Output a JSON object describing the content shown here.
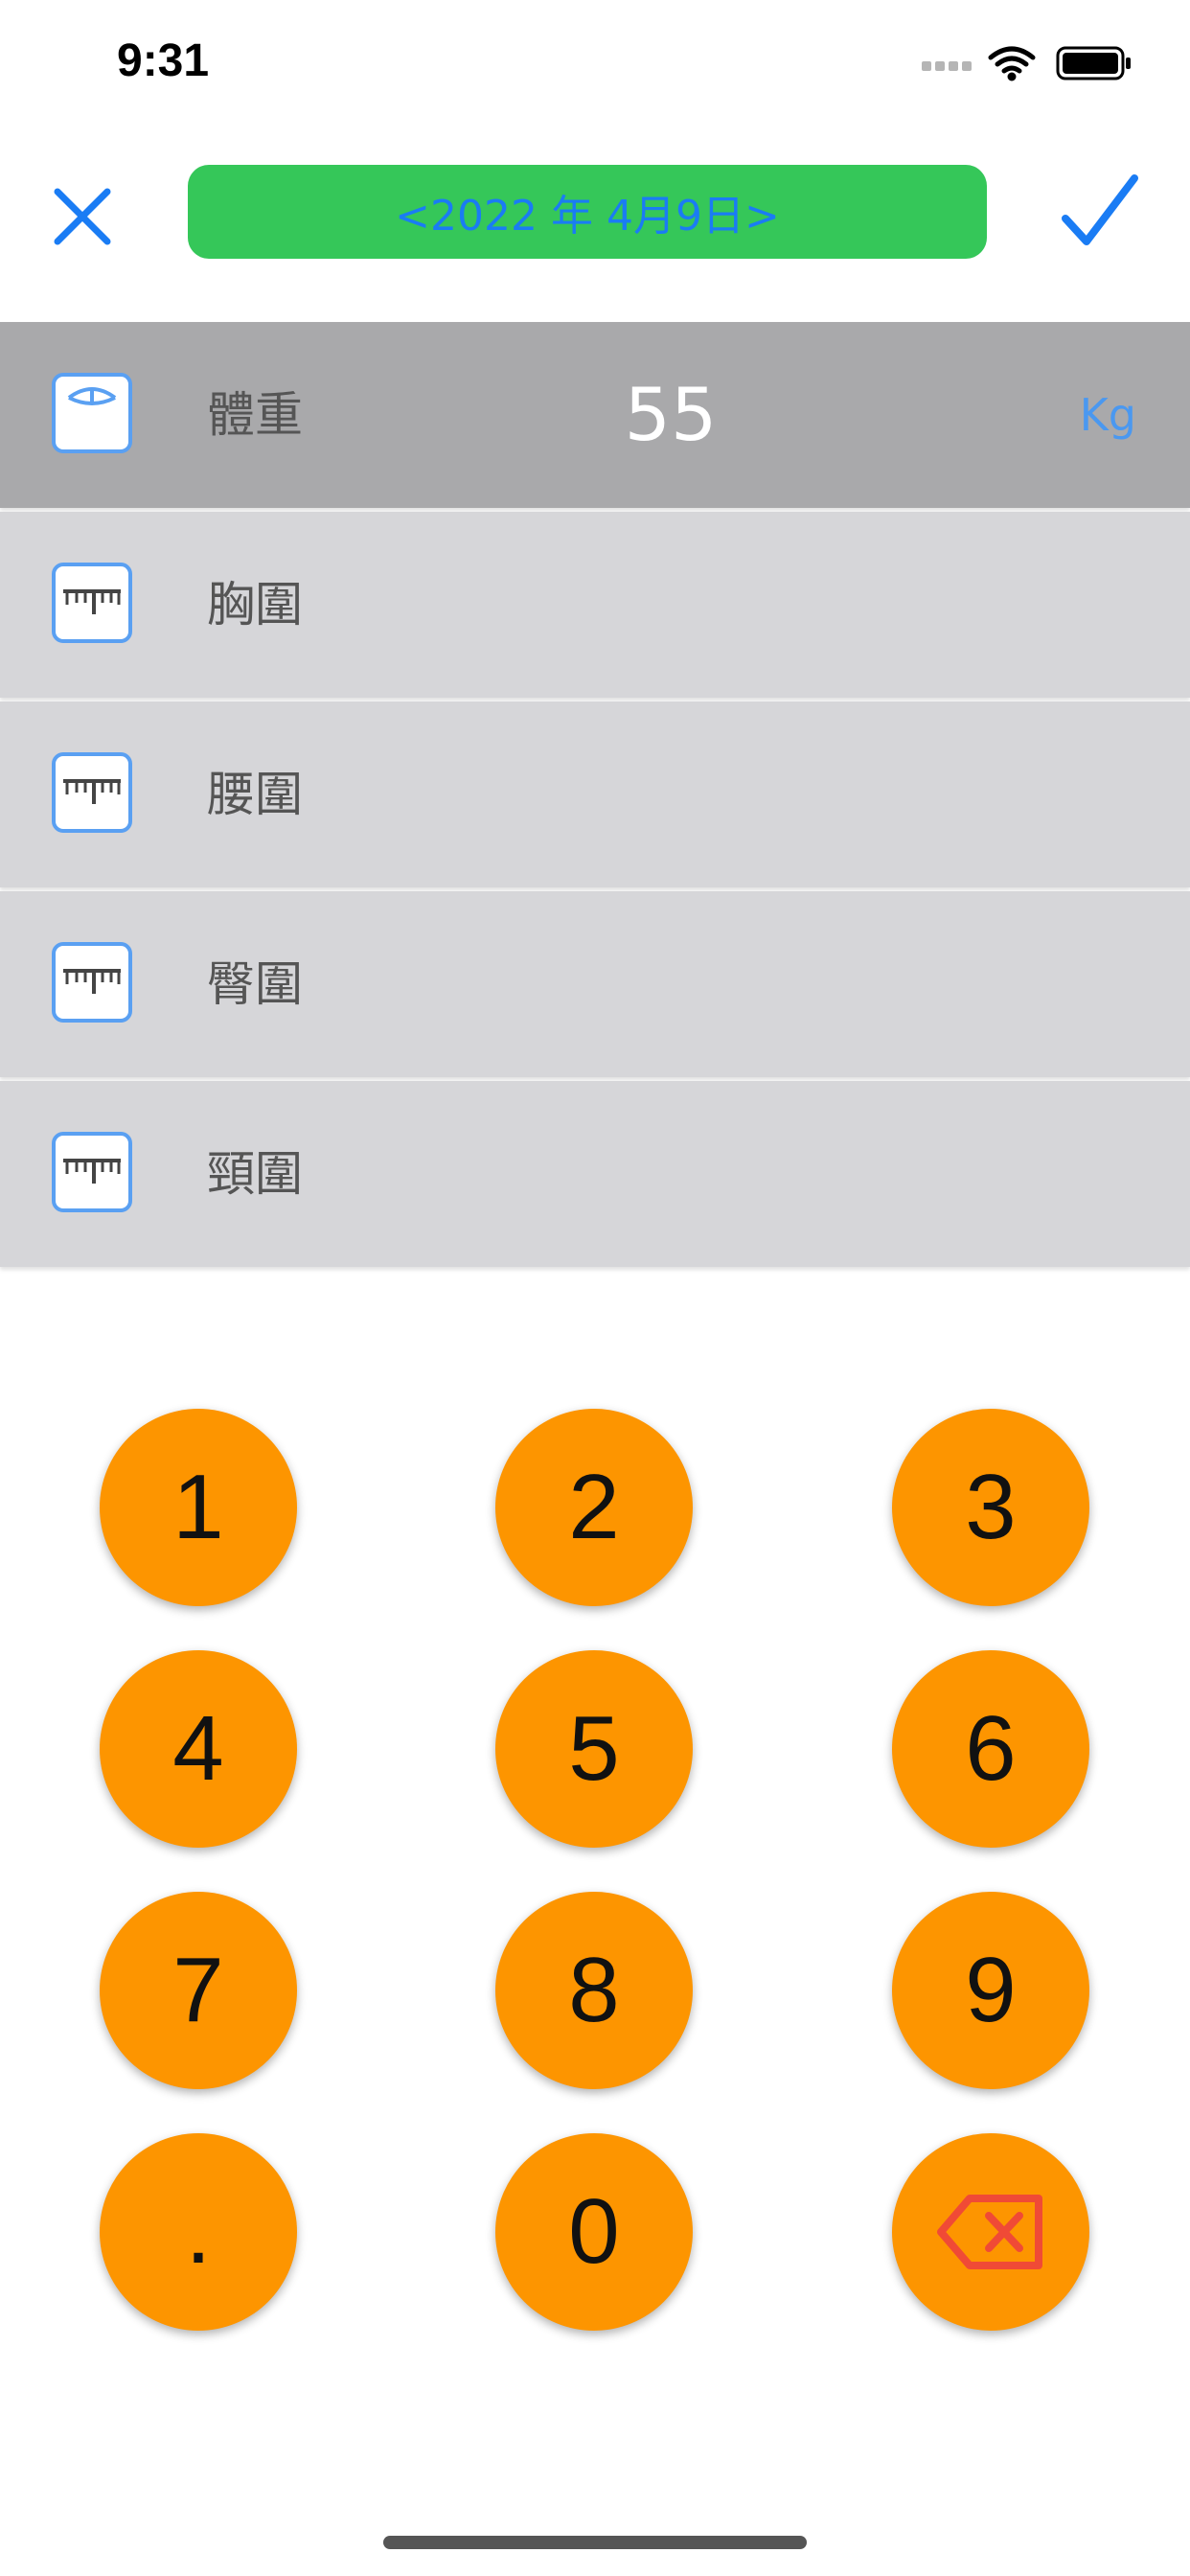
{
  "status_bar": {
    "time": "9:31"
  },
  "nav": {
    "close_icon": "close-icon",
    "confirm_icon": "checkmark-icon",
    "date_label": "<2022 年 4月9日>"
  },
  "measurements": [
    {
      "icon": "scale-icon",
      "label": "體重",
      "value": "55",
      "unit": "Kg",
      "selected": true
    },
    {
      "icon": "ruler-icon",
      "label": "胸圍",
      "value": "",
      "unit": "",
      "selected": false
    },
    {
      "icon": "ruler-icon",
      "label": "腰圍",
      "value": "",
      "unit": "",
      "selected": false
    },
    {
      "icon": "ruler-icon",
      "label": "臀圍",
      "value": "",
      "unit": "",
      "selected": false
    },
    {
      "icon": "ruler-icon",
      "label": "頸圍",
      "value": "",
      "unit": "",
      "selected": false
    }
  ],
  "keypad": {
    "keys": [
      "1",
      "2",
      "3",
      "4",
      "5",
      "6",
      "7",
      "8",
      "9",
      ".",
      "0"
    ],
    "backspace_icon": "backspace-icon"
  },
  "colors": {
    "accent_blue": "#1a7cf4",
    "date_pill_bg": "#35c759",
    "row_selected_bg": "#a9a9ab",
    "row_bg": "#d6d6d9",
    "key_bg": "#fd9500",
    "backspace_red": "#f04a36",
    "unit_blue": "#4a98f0"
  }
}
